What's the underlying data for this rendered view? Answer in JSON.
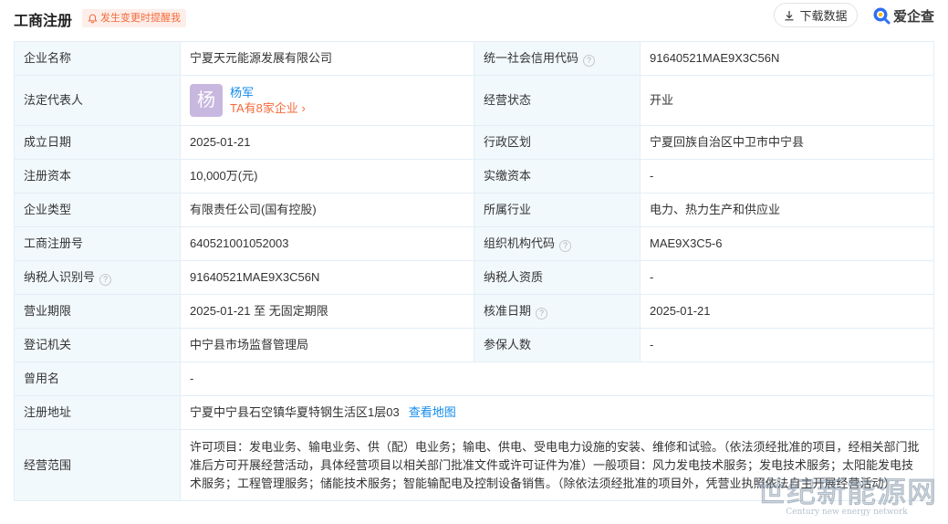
{
  "header": {
    "title": "工商注册",
    "remind_label": "发生变更时提醒我",
    "download_label": "下载数据",
    "brand_label": "爱企查"
  },
  "rows": {
    "r1": {
      "l1": "企业名称",
      "v1": "宁夏天元能源发展有限公司",
      "l2": "统一社会信用代码",
      "v2": "91640521MAE9X3C56N"
    },
    "r2": {
      "l1": "法定代表人",
      "avatar": "杨",
      "name": "杨军",
      "count": "TA有8家企业",
      "l2": "经营状态",
      "v2": "开业"
    },
    "r3": {
      "l1": "成立日期",
      "v1": "2025-01-21",
      "l2": "行政区划",
      "v2": "宁夏回族自治区中卫市中宁县"
    },
    "r4": {
      "l1": "注册资本",
      "v1": "10,000万(元)",
      "l2": "实缴资本",
      "v2": "-"
    },
    "r5": {
      "l1": "企业类型",
      "v1": "有限责任公司(国有控股)",
      "l2": "所属行业",
      "v2": "电力、热力生产和供应业"
    },
    "r6": {
      "l1": "工商注册号",
      "v1": "640521001052003",
      "l2": "组织机构代码",
      "v2": "MAE9X3C5-6"
    },
    "r7": {
      "l1": "纳税人识别号",
      "v1": "91640521MAE9X3C56N",
      "l2": "纳税人资质",
      "v2": "-"
    },
    "r8": {
      "l1": "营业期限",
      "v1": "2025-01-21 至 无固定期限",
      "l2": "核准日期",
      "v2": "2025-01-21"
    },
    "r9": {
      "l1": "登记机关",
      "v1": "中宁县市场监督管理局",
      "l2": "参保人数",
      "v2": "-"
    },
    "r10": {
      "l1": "曾用名",
      "v1": "-"
    },
    "r11": {
      "l1": "注册地址",
      "v1": "宁夏中宁县石空镇华夏特钢生活区1层03",
      "link": "查看地图"
    },
    "r12": {
      "l1": "经营范围",
      "v1": "许可项目：发电业务、输电业务、供（配）电业务；输电、供电、受电电力设施的安装、维修和试验。（依法须经批准的项目，经相关部门批准后方可开展经营活动，具体经营项目以相关部门批准文件或许可证件为准）一般项目：风力发电技术服务；发电技术服务；太阳能发电技术服务；工程管理服务；储能技术服务；智能输配电及控制设备销售。（除依法须经批准的项目外，凭营业执照依法自主开展经营活动）"
    }
  },
  "watermark": {
    "main": "世纪新能源网",
    "sub": "Century new energy network"
  },
  "colors": {
    "accent_blue": "#128bed",
    "accent_orange": "#f36c3d",
    "label_bg": "#f2f9fc",
    "border": "#e4eef6",
    "avatar_bg": "#c8b7df"
  }
}
